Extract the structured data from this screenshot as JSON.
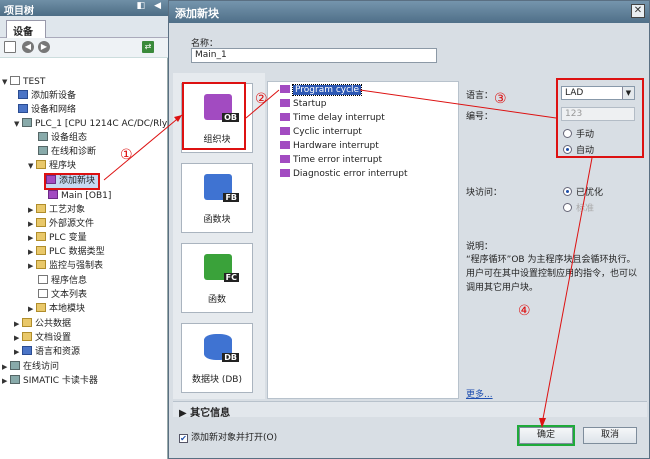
{
  "left_panel": {
    "title": "项目树",
    "tab": "设备",
    "tree": [
      {
        "label": "TEST",
        "level": 0
      },
      {
        "label": "添加新设备",
        "level": 1
      },
      {
        "label": "设备和网络",
        "level": 1
      },
      {
        "label": "PLC_1 [CPU 1214C AC/DC/Rly]",
        "level": 1
      },
      {
        "label": "设备组态",
        "level": 2
      },
      {
        "label": "在线和诊断",
        "level": 2
      },
      {
        "label": "程序块",
        "level": 2
      },
      {
        "label": "添加新块",
        "level": 3
      },
      {
        "label": "Main [OB1]",
        "level": 3
      },
      {
        "label": "工艺对象",
        "level": 2
      },
      {
        "label": "外部源文件",
        "level": 2
      },
      {
        "label": "PLC 变量",
        "level": 2
      },
      {
        "label": "PLC 数据类型",
        "level": 2
      },
      {
        "label": "监控与强制表",
        "level": 2
      },
      {
        "label": "程序信息",
        "level": 2
      },
      {
        "label": "文本列表",
        "level": 2
      },
      {
        "label": "本地模块",
        "level": 2
      },
      {
        "label": "公共数据",
        "level": 1
      },
      {
        "label": "文档设置",
        "level": 1
      },
      {
        "label": "语言和资源",
        "level": 1
      },
      {
        "label": "在线访问",
        "level": 0
      },
      {
        "label": "SIMATIC 卡读卡器",
        "level": 0
      }
    ]
  },
  "dialog": {
    "title": "添加新块",
    "name_label": "名称：",
    "name_value": "Main_1",
    "block_types": [
      {
        "label": "组织块",
        "tag": "OB",
        "color": "#a24bc1"
      },
      {
        "label": "函数块",
        "tag": "FB",
        "color": "#3f73d2"
      },
      {
        "label": "函数",
        "tag": "FC",
        "color": "#3aa23a"
      },
      {
        "label": "数据块 (DB)",
        "tag": "DB",
        "color": "#3f73d2"
      }
    ],
    "ob_list": [
      "Program cycle",
      "Startup",
      "Time delay interrupt",
      "Cyclic interrupt",
      "Hardware interrupt",
      "Time error interrupt",
      "Diagnostic error interrupt"
    ],
    "language_label": "语言：",
    "language_value": "LAD",
    "number_label": "编号：",
    "number_value": "123",
    "manual_label": "手动",
    "auto_label": "自动",
    "access_label": "块访问：",
    "optimized_label": "已优化",
    "standard_label": "标准",
    "desc_label": "说明：",
    "desc_text": "“程序循环”OB 为主程序块且会循环执行。用户可在其中设置控制应用的指令，也可以调用其它用户块。",
    "more_link": "更多...",
    "more_info": "其它信息",
    "open_checkbox": "添加新对象并打开(O)",
    "ok_label": "确定",
    "cancel_label": "取消"
  },
  "annotations": [
    "①",
    "②",
    "③",
    "④"
  ]
}
